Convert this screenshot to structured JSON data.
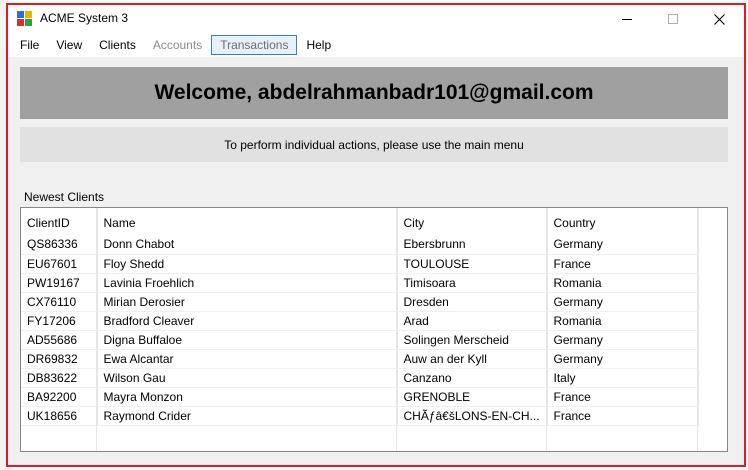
{
  "window": {
    "title": "ACME System 3",
    "frame_color": "#e01b24"
  },
  "menu": {
    "items": [
      {
        "label": "File",
        "state": "enabled"
      },
      {
        "label": "View",
        "state": "enabled"
      },
      {
        "label": "Clients",
        "state": "enabled"
      },
      {
        "label": "Accounts",
        "state": "disabled"
      },
      {
        "label": "Transactions",
        "state": "selected"
      },
      {
        "label": "Help",
        "state": "enabled"
      }
    ]
  },
  "welcome": {
    "text": "Welcome, abdelrahmanbadr101@gmail.com"
  },
  "info": {
    "text": "To perform individual actions, please use the main menu"
  },
  "clients": {
    "section_label": "Newest Clients",
    "columns": [
      "ClientID",
      "Name",
      "City",
      "Country"
    ],
    "rows": [
      [
        "QS86336",
        "Donn Chabot",
        "Ebersbrunn",
        "Germany"
      ],
      [
        "EU67601",
        "Floy Shedd",
        "TOULOUSE",
        "France"
      ],
      [
        "PW19167",
        "Lavinia Froehlich",
        "Timisoara",
        "Romania"
      ],
      [
        "CX76110",
        "Mirian Derosier",
        "Dresden",
        "Germany"
      ],
      [
        "FY17206",
        "Bradford Cleaver",
        "Arad",
        "Romania"
      ],
      [
        "AD55686",
        "Digna Buffaloe",
        "Solingen Merscheid",
        "Germany"
      ],
      [
        "DR69832",
        "Ewa Alcantar",
        "Auw an der Kyll",
        "Germany"
      ],
      [
        "DB83622",
        "Wilson Gau",
        "Canzano",
        "Italy"
      ],
      [
        "BA92200",
        "Mayra Monzon",
        "GRENOBLE",
        "France"
      ],
      [
        "UK18656",
        "Raymond Crider",
        "CHÃƒâ€šLONS-EN-CH...",
        "France"
      ]
    ]
  },
  "icons": {
    "app": "app-window-icon",
    "minimize": "minimize-icon",
    "maximize": "maximize-icon",
    "close": "close-icon"
  }
}
